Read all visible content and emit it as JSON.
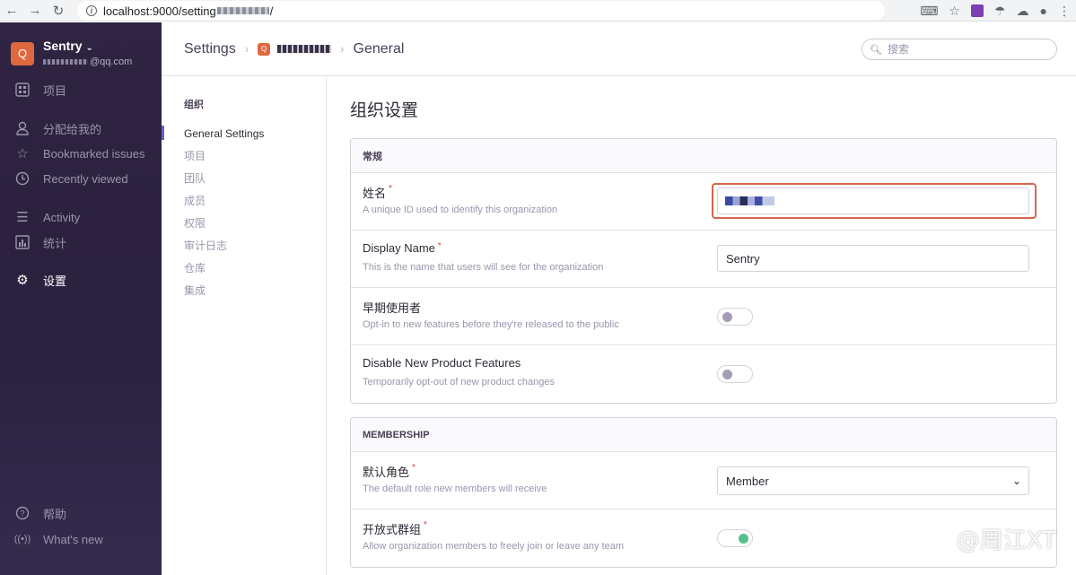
{
  "browser": {
    "url_prefix": "localhost:9000/setting",
    "url_suffix": "/"
  },
  "sidebar": {
    "org_initial": "Q",
    "org_name": "Sentry",
    "org_email_suffix": "@qq.com",
    "items": [
      {
        "label": "项目",
        "icon": "projects-icon"
      },
      {
        "label": "分配给我的",
        "icon": "user-icon"
      },
      {
        "label": "Bookmarked issues",
        "icon": "star-icon"
      },
      {
        "label": "Recently viewed",
        "icon": "clock-icon"
      },
      {
        "label": "Activity",
        "icon": "activity-icon"
      },
      {
        "label": "统计",
        "icon": "stats-icon"
      },
      {
        "label": "设置",
        "icon": "gear-icon"
      },
      {
        "label": "帮助",
        "icon": "help-icon"
      },
      {
        "label": "What's new",
        "icon": "broadcast-icon"
      }
    ]
  },
  "header": {
    "crumb_settings": "Settings",
    "crumb_org_initial": "Q",
    "crumb_general": "General",
    "search_placeholder": "搜索"
  },
  "settings_nav": {
    "heading": "组织",
    "links": [
      "General Settings",
      "项目",
      "团队",
      "成员",
      "权限",
      "审计日志",
      "仓库",
      "集成"
    ]
  },
  "main": {
    "title": "组织设置",
    "general_panel": {
      "header": "常规",
      "name_label": "姓名",
      "name_help": "A unique ID used to identify this organization",
      "display_name_label": "Display Name",
      "display_name_help": "This is the name that users will see for the organization",
      "display_name_value": "Sentry",
      "early_label": "早期使用者",
      "early_help": "Opt-in to new features before they're released to the public",
      "disable_label": "Disable New Product Features",
      "disable_help": "Temporarily opt-out of new product changes"
    },
    "membership_panel": {
      "header": "MEMBERSHIP",
      "role_label": "默认角色",
      "role_help": "The default role new members will receive",
      "role_value": "Member",
      "open_label": "开放式群组",
      "open_help": "Allow organization members to freely join or leave any team"
    }
  },
  "required_mark": "*",
  "watermark": "@周江XT"
}
